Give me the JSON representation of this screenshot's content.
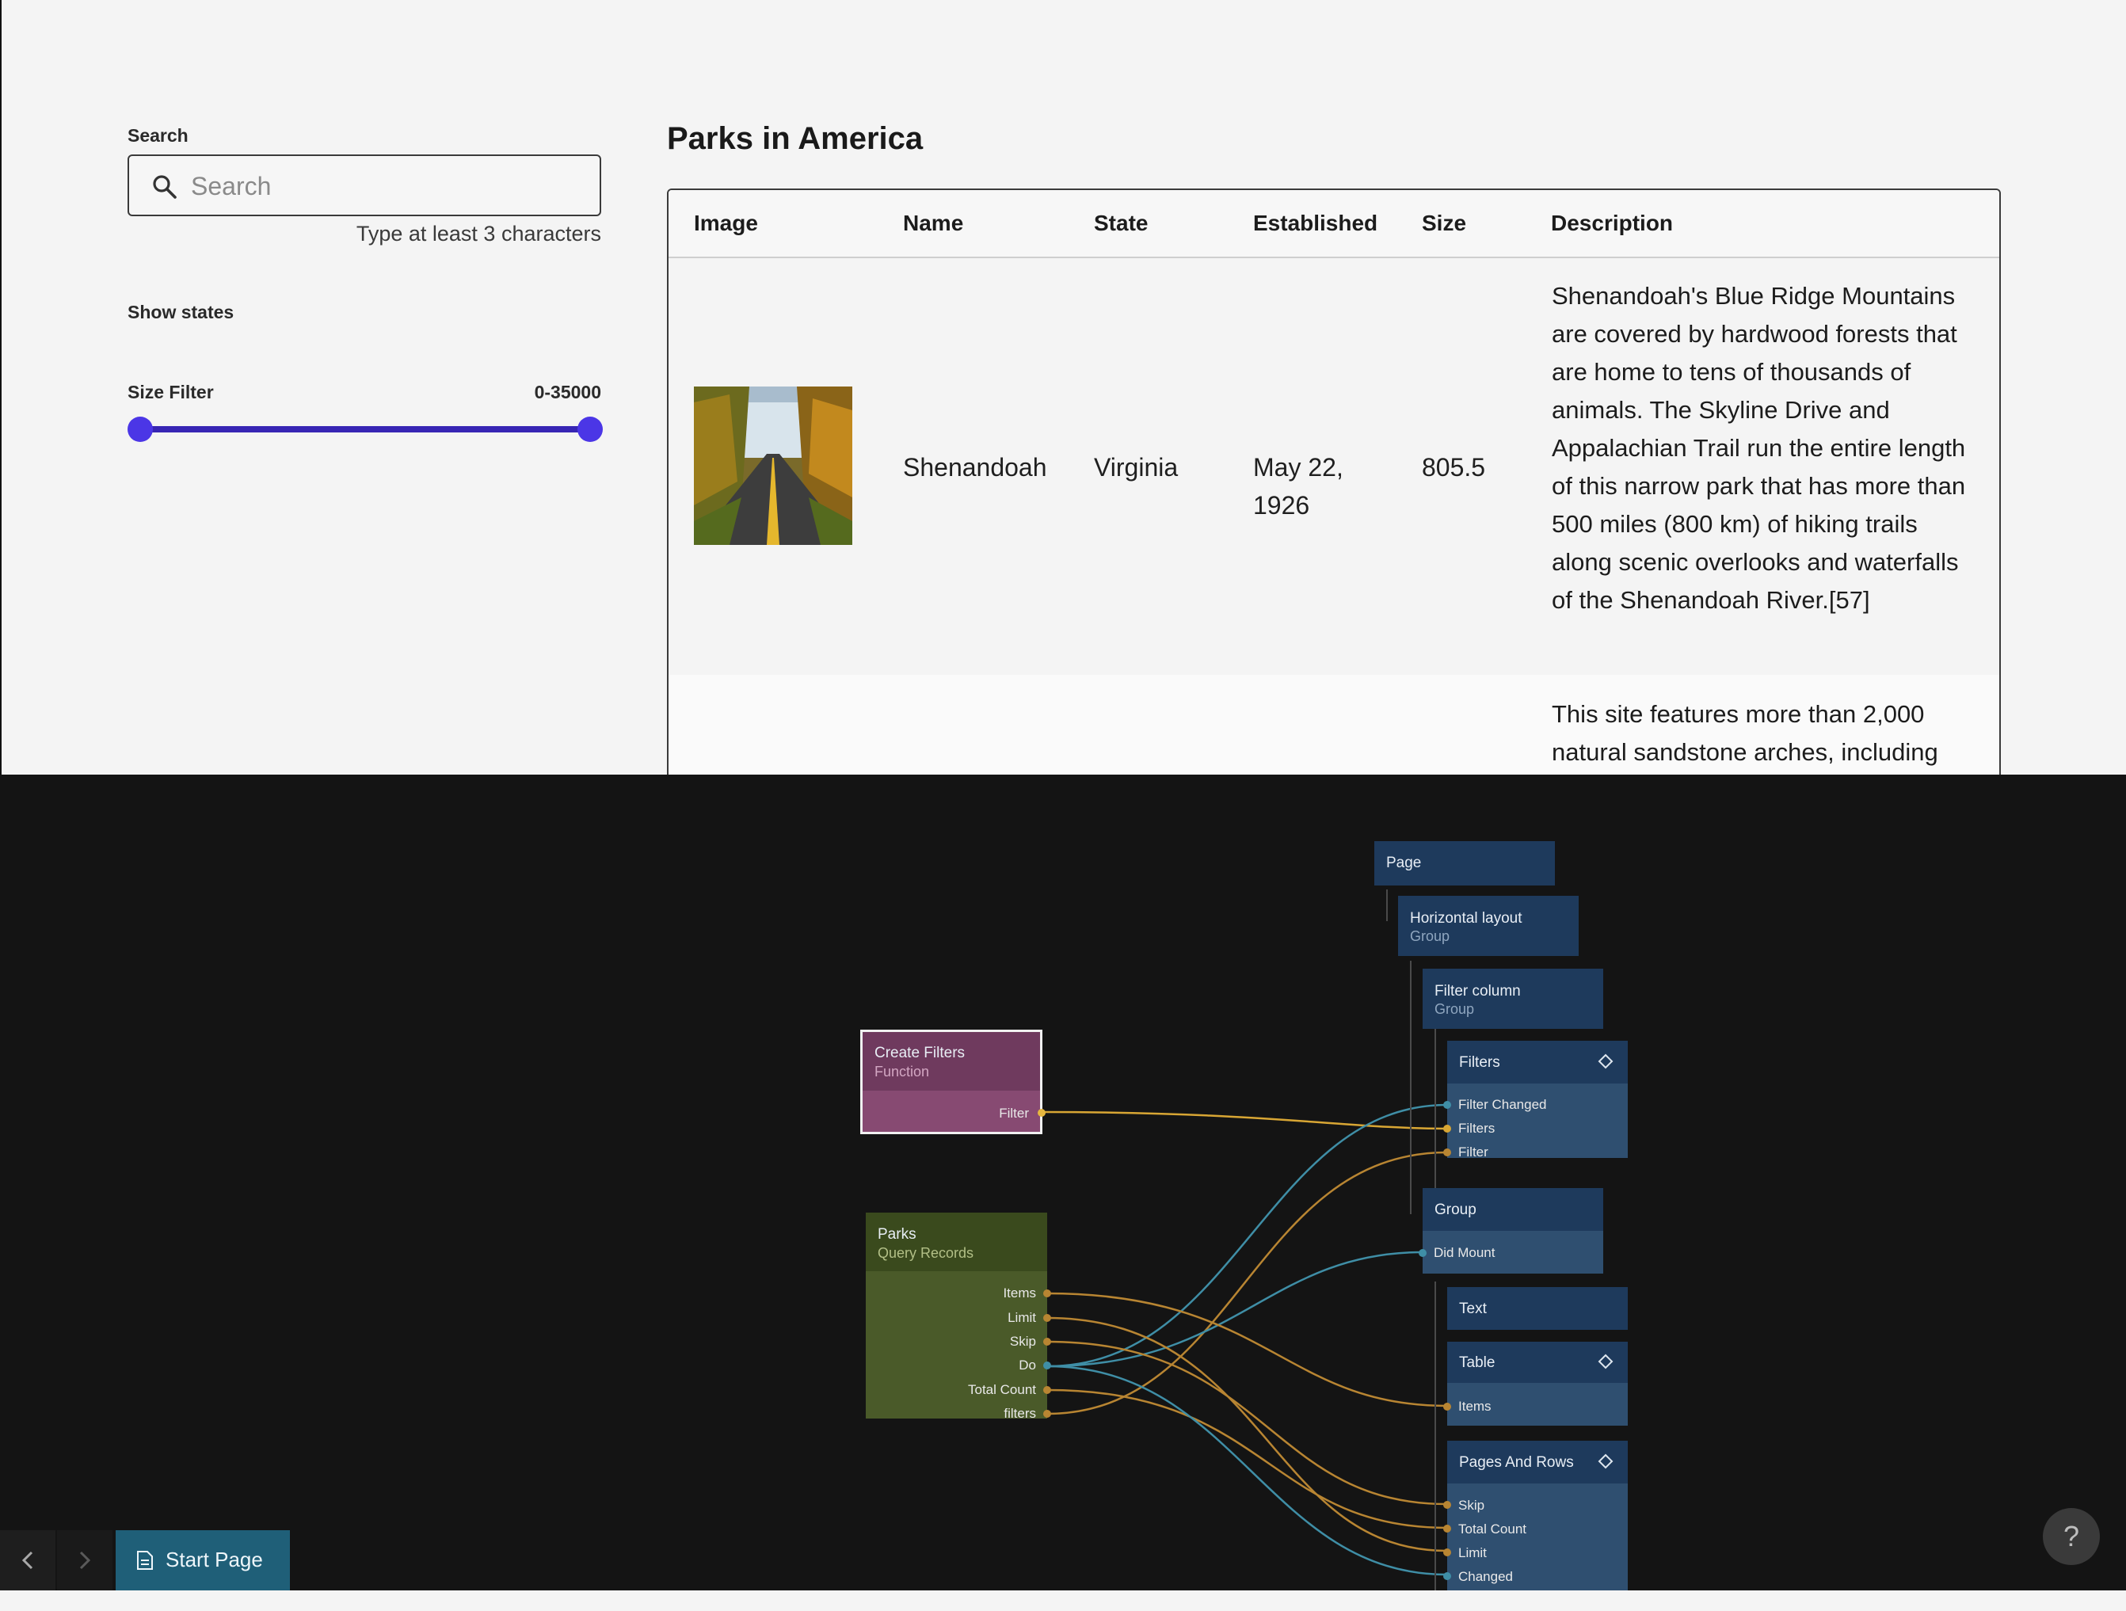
{
  "preview": {
    "search": {
      "label": "Search",
      "placeholder": "Search",
      "hint": "Type at least 3 characters"
    },
    "show_states_label": "Show states",
    "size_filter": {
      "label": "Size Filter",
      "range_text": "0-35000"
    },
    "title": "Parks in America",
    "table": {
      "headers": [
        "Image",
        "Name",
        "State",
        "Established",
        "Size",
        "Description"
      ],
      "rows": [
        {
          "name": "Shenandoah",
          "state": "Virginia",
          "established": "May 22, 1926",
          "size": "805.5",
          "description": "Shenandoah's Blue Ridge Mountains are covered by hardwood forests that are home to tens of thousands of animals. The Skyline Drive and Appalachian Trail run the entire length of this narrow park that has more than 500 miles (800 km) of hiking trails along scenic overlooks and waterfalls of the Shenandoah River.[57]"
        },
        {
          "description": "This site features more than 2,000 natural sandstone arches, including"
        }
      ]
    }
  },
  "editor": {
    "nodes": {
      "create_filters": {
        "title": "Create Filters",
        "subtitle": "Function",
        "ports": [
          "Filter"
        ]
      },
      "parks": {
        "title": "Parks",
        "subtitle": "Query Records",
        "ports": [
          "Items",
          "Limit",
          "Skip",
          "Do",
          "Total Count",
          "filters"
        ]
      },
      "page": {
        "title": "Page"
      },
      "horizontal_layout": {
        "title": "Horizontal layout",
        "subtitle": "Group"
      },
      "filter_column": {
        "title": "Filter column",
        "subtitle": "Group"
      },
      "filters": {
        "title": "Filters",
        "ports": [
          "Filter Changed",
          "Filters",
          "Filter"
        ]
      },
      "group": {
        "title": "Group",
        "ports": [
          "Did Mount"
        ]
      },
      "text": {
        "title": "Text"
      },
      "table": {
        "title": "Table",
        "ports": [
          "Items"
        ]
      },
      "pages_and_rows": {
        "title": "Pages And Rows",
        "ports": [
          "Skip",
          "Total Count",
          "Limit",
          "Changed"
        ]
      }
    },
    "colors": {
      "link_yellow": "#d8a634",
      "link_orange": "#b88532",
      "link_teal": "#3f8ea6"
    }
  },
  "bottom": {
    "start_tab": "Start Page",
    "help": "?"
  }
}
